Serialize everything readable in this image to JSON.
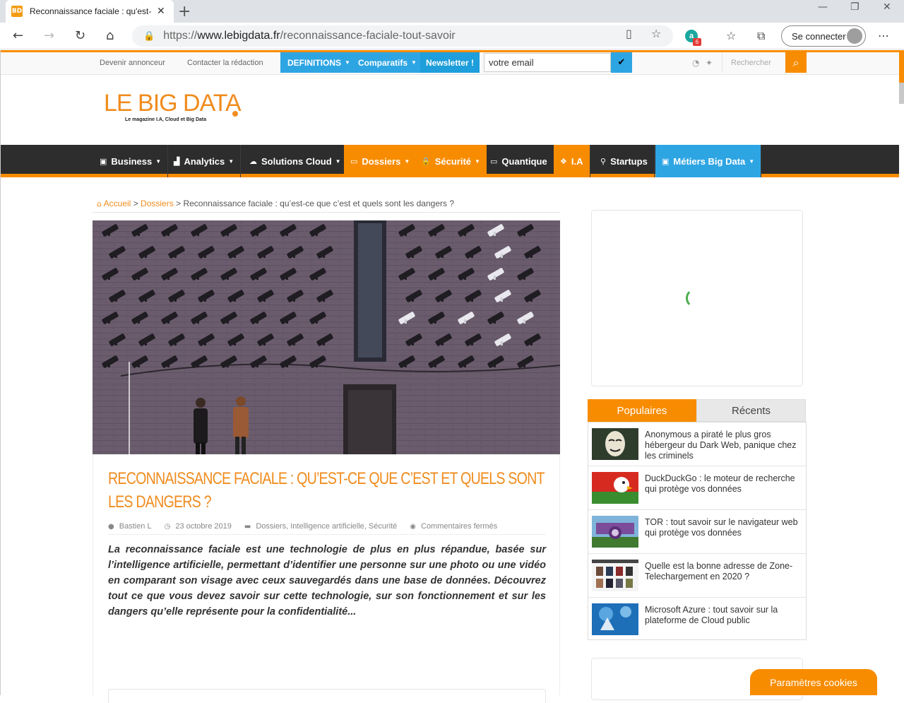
{
  "browser": {
    "tab_title": "Reconnaissance faciale : qu'est-c",
    "tab_favicon": "BD",
    "url_prefix": "https://",
    "url_host": "www.lebigdata.fr",
    "url_path": "/reconnaissance-faciale-tout-savoir",
    "signin_label": "Se connecter",
    "ext_badge": "6"
  },
  "topbar": {
    "link_advertise": "Devenir annonceur",
    "link_contact": "Contacter la rédaction",
    "menu_definitions": "DEFINITIONS",
    "menu_comparatifs": "Comparatifs",
    "newsletter_label": "Newsletter !",
    "newsletter_placeholder": "votre email",
    "search_placeholder": "Rechercher"
  },
  "logo": {
    "main": "LE BIG DATA",
    "tagline": "Le magazine I.A, Cloud et Big Data"
  },
  "nav": [
    {
      "label": "Business",
      "icon": "briefcase-icon"
    },
    {
      "label": "Analytics",
      "icon": "chart-icon"
    },
    {
      "label": "Solutions Cloud",
      "icon": "cloud-icon"
    },
    {
      "label": "Dossiers",
      "icon": "folder-icon"
    },
    {
      "label": "Sécurité",
      "icon": "lock-icon"
    },
    {
      "label": "Quantique",
      "icon": "laptop-icon"
    },
    {
      "label": "I.A",
      "icon": "cubes-icon"
    },
    {
      "label": "Startups",
      "icon": "marker-icon"
    },
    {
      "label": "Métiers Big Data",
      "icon": "briefcase-icon"
    }
  ],
  "breadcrumb": {
    "home": "Accueil",
    "sep1": ">",
    "section": "Dossiers",
    "sep2": ">",
    "current": "Reconnaissance faciale : qu’est-ce que c’est et quels sont les dangers ?"
  },
  "article": {
    "title": "Reconnaissance faciale : qu’est-ce que c’est et quels sont les dangers ?",
    "author": "Bastien L",
    "date": "23 octobre 2019",
    "cat1": "Dossiers",
    "cat2": "Intelligence artificielle",
    "cat3": "Sécurité",
    "comments": "Commentaires fermés",
    "lead": "La reconnaissance faciale est une technologie de plus en plus répandue, basée sur l’intelligence artificielle, permettant d’identifier une personne sur une photo ou une vidéo en comparant son visage avec ceux sauvegardés dans une base de données. Découvrez tout ce que vous devez savoir sur cette technologie, sur son fonctionnement et sur les dangers qu’elle représente pour la confidentialité..."
  },
  "sidebar": {
    "tab_popular": "Populaires",
    "tab_recent": "Récents",
    "items": [
      {
        "title": "Anonymous a piraté le plus gros hébergeur du Dark Web, panique chez les criminels"
      },
      {
        "title": "DuckDuckGo : le moteur de recherche qui protège vos données"
      },
      {
        "title": "TOR : tout savoir sur le navigateur web qui protège vos données"
      },
      {
        "title": "Quelle est la bonne adresse de Zone-Telechargement en 2020 ?"
      },
      {
        "title": "Microsoft Azure : tout savoir sur la plateforme de Cloud public"
      }
    ]
  },
  "cookie_button": "Paramètres cookies",
  "colors": {
    "accent": "#f88c00",
    "blue": "#2ea5e3",
    "nav_bg": "#2d2d2d"
  }
}
